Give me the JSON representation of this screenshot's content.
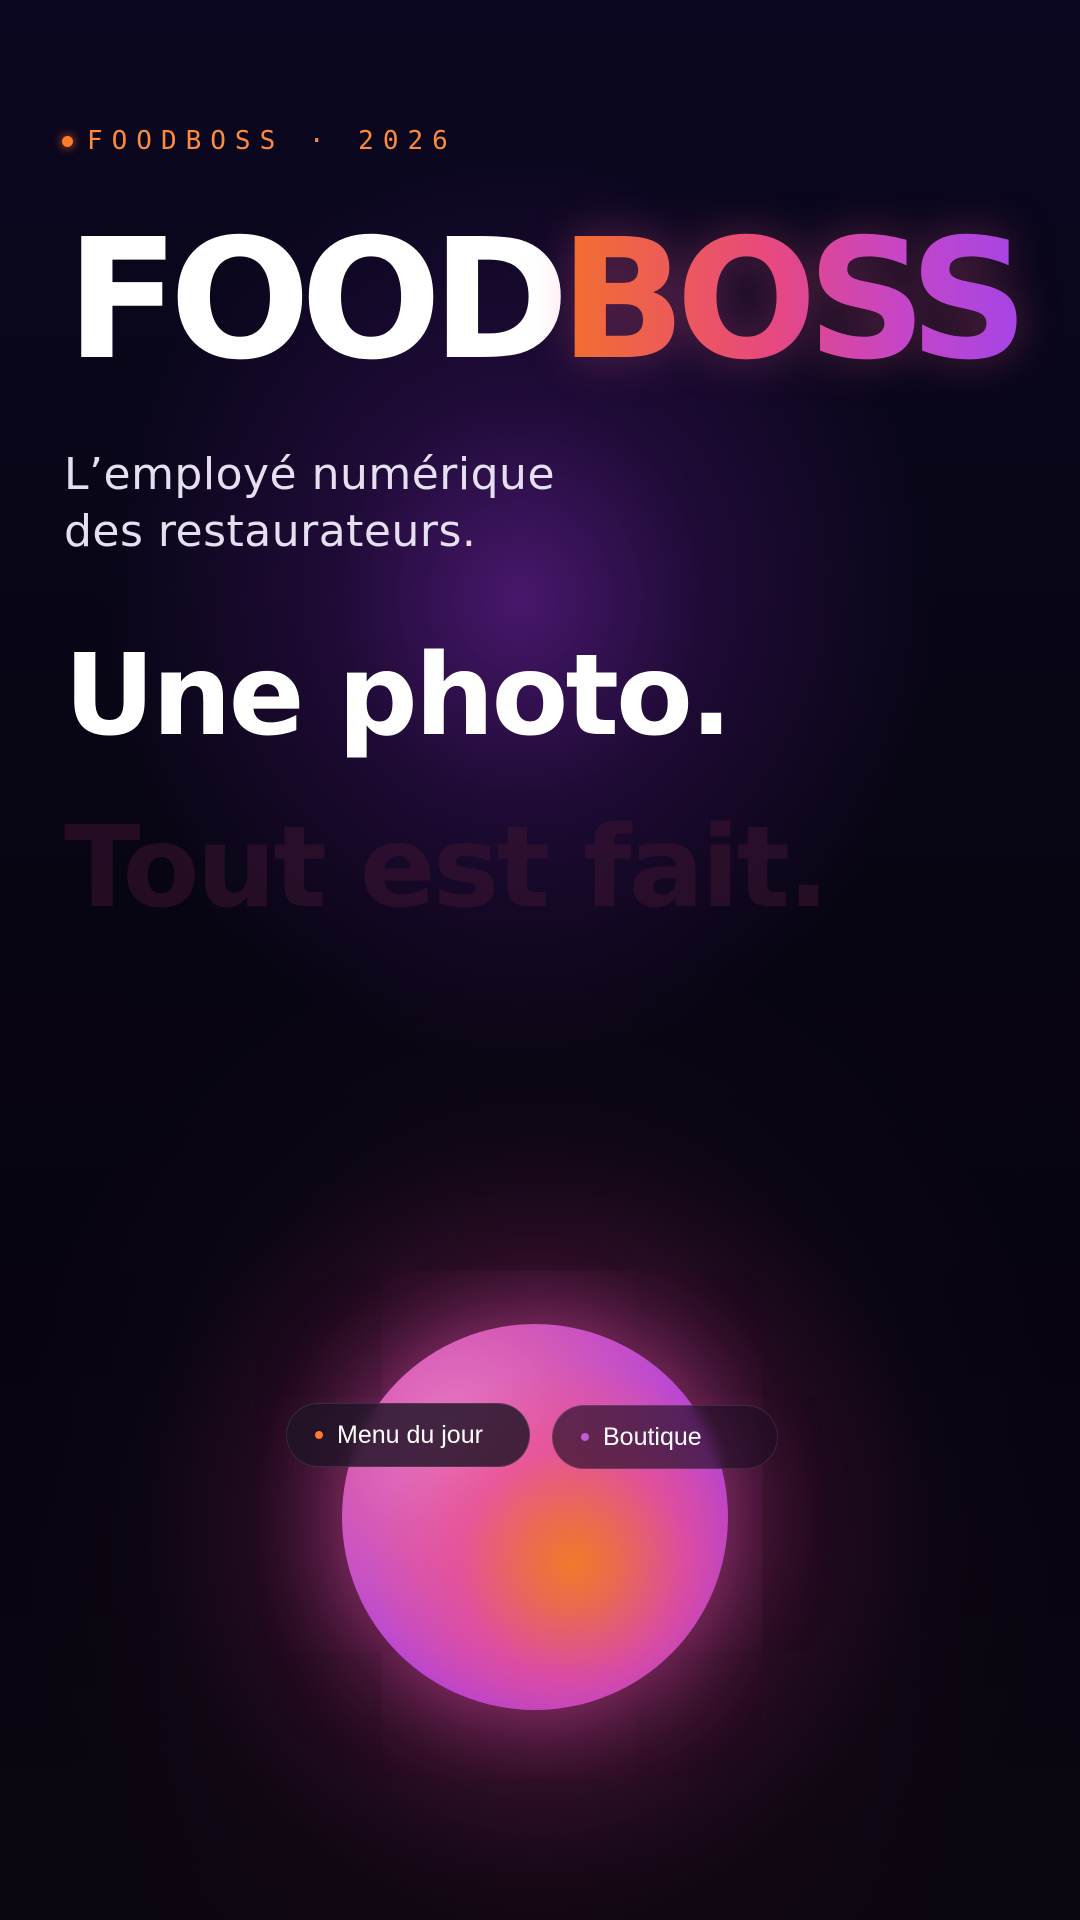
{
  "eyebrow": {
    "dot_color": "#ff7a2a",
    "text": "FOODBOSS · 2026"
  },
  "logo": {
    "part_light": "FOOD",
    "part_gradient": "BOSS",
    "gradient_colors": [
      "#f2702c",
      "#e8497d",
      "#c545c8",
      "#a545e6"
    ]
  },
  "subtitle": {
    "line1": "L’employé numérique",
    "line2": "des restaurateurs."
  },
  "headline": {
    "primary": "Une photo.",
    "secondary": "Tout est fait."
  },
  "orb": {
    "colors": [
      "#8e35ea",
      "#e97ac2",
      "#f07a2a"
    ]
  },
  "chips": {
    "menu": {
      "label": "Menu du jour",
      "dot_color": "#ff7a2a"
    },
    "boutique": {
      "label": "Boutique",
      "dot_color": "#c35ad6"
    }
  }
}
